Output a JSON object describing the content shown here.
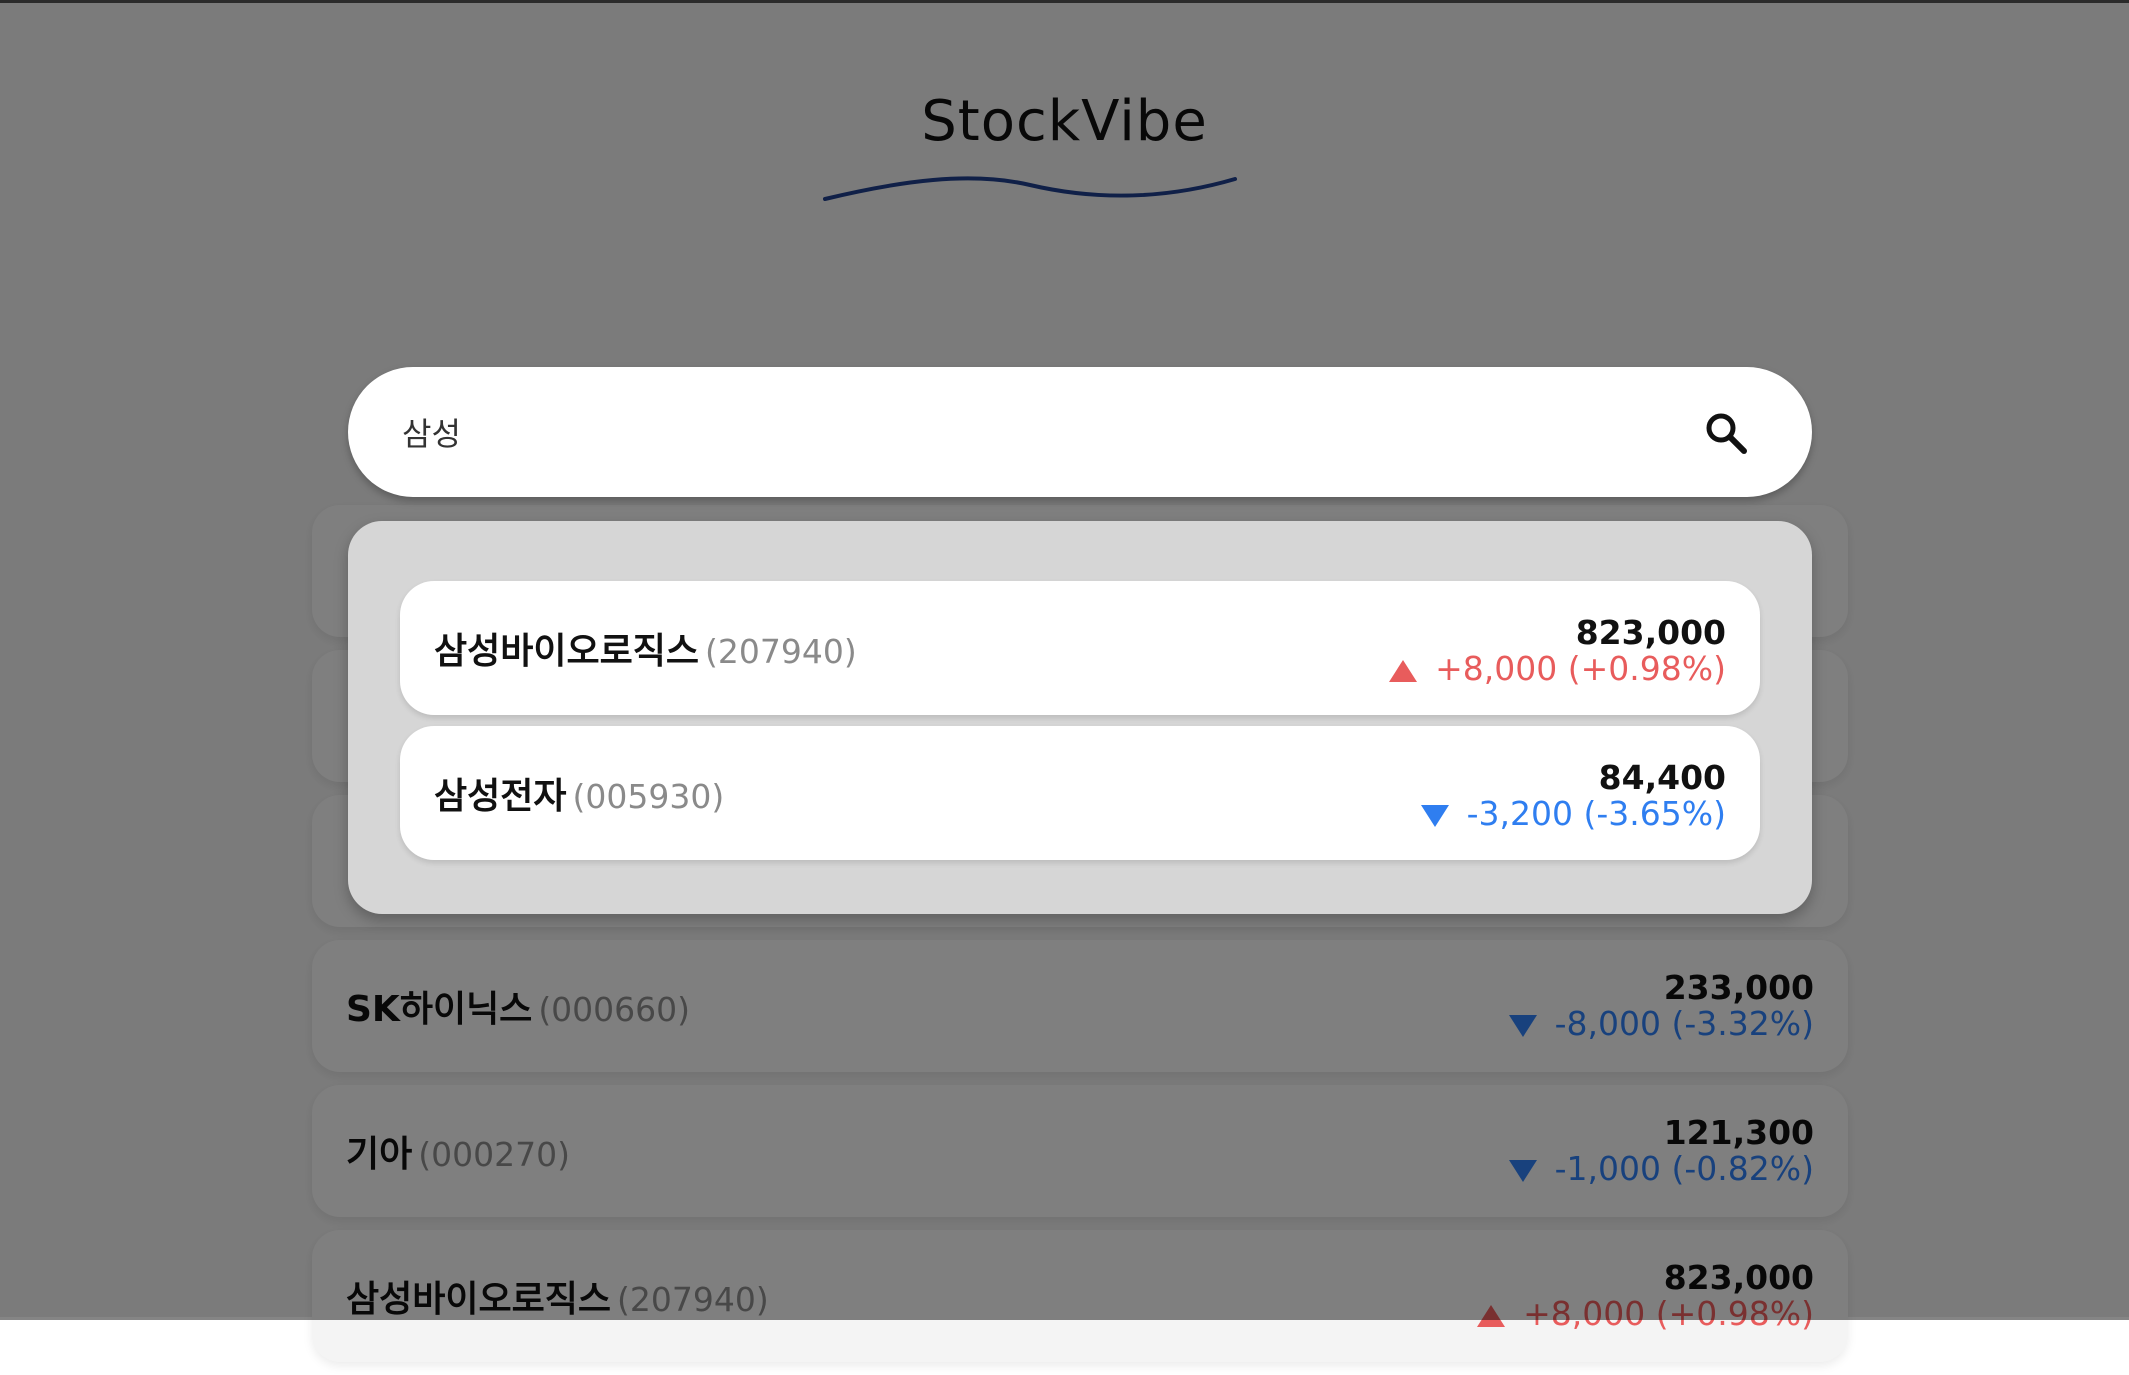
{
  "app": {
    "title": "StockVibe"
  },
  "search": {
    "value": "삼성"
  },
  "suggestions": [
    {
      "name": "삼성바이오로직스",
      "code": "(207940)",
      "price": "823,000",
      "change": "+8,000 (+0.98%)",
      "direction": "up"
    },
    {
      "name": "삼성전자",
      "code": "(005930)",
      "price": "84,400",
      "change": "-3,200 (-3.65%)",
      "direction": "down"
    }
  ],
  "stock_list": [
    {
      "name": "",
      "code": "",
      "price": "",
      "change": "",
      "direction": ""
    },
    {
      "name": "",
      "code": "",
      "price": "",
      "change": "",
      "direction": ""
    },
    {
      "name": "",
      "code": "",
      "price": "",
      "change": "",
      "direction": ""
    },
    {
      "name": "SK하이닉스",
      "code": "(000660)",
      "price": "233,000",
      "change": "-8,000 (-3.32%)",
      "direction": "down"
    },
    {
      "name": "기아",
      "code": "(000270)",
      "price": "121,300",
      "change": "-1,000 (-0.82%)",
      "direction": "down"
    },
    {
      "name": "삼성바이오로직스",
      "code": "(207940)",
      "price": "823,000",
      "change": "+8,000 (+0.98%)",
      "direction": "up"
    }
  ],
  "colors": {
    "up": "#e85c5c",
    "down": "#2f7ef0",
    "brand_wave": "#1f3f8a"
  },
  "icons": {
    "search": "search-icon",
    "up": "triangle-up-icon",
    "down": "triangle-down-icon"
  }
}
